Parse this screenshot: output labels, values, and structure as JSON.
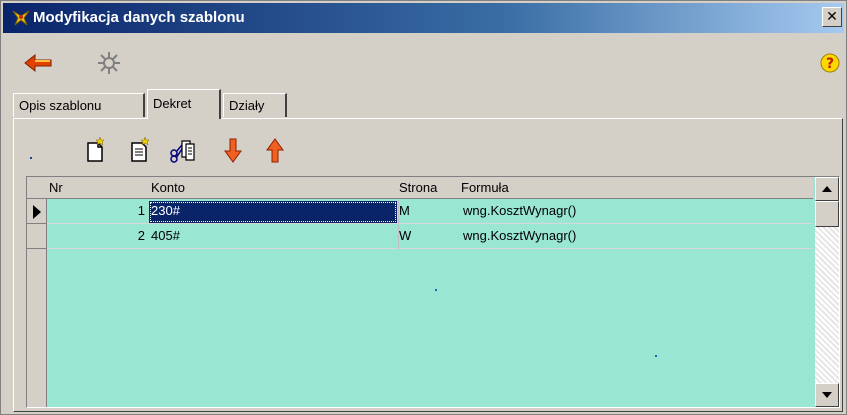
{
  "window": {
    "title": "Modyfikacja danych szablonu",
    "close_glyph": "✕",
    "accent": "#0a246a"
  },
  "toolbar": {
    "back_icon": "back-arrow-icon",
    "settings_icon": "gear-icon",
    "help_icon": "help-icon"
  },
  "tabs": [
    {
      "label": "Opis szablonu",
      "active": false
    },
    {
      "label": "Dekret",
      "active": true
    },
    {
      "label": "Działy",
      "active": false
    }
  ],
  "inner_toolbar": {
    "icons": [
      "new-document-icon",
      "edit-document-icon",
      "copy-document-icon",
      "move-down-icon",
      "move-up-icon"
    ]
  },
  "grid": {
    "columns": [
      "Nr",
      "Konto",
      "Strona",
      "Formuła"
    ],
    "rows": [
      {
        "nr": "1",
        "konto": "230#",
        "strona": "M",
        "formula": "wng.KosztWynagr()"
      },
      {
        "nr": "2",
        "konto": "405#",
        "strona": "W",
        "formula": "wng.KosztWynagr()"
      }
    ],
    "background": "#99e6d3",
    "selection": "#0a246a"
  }
}
